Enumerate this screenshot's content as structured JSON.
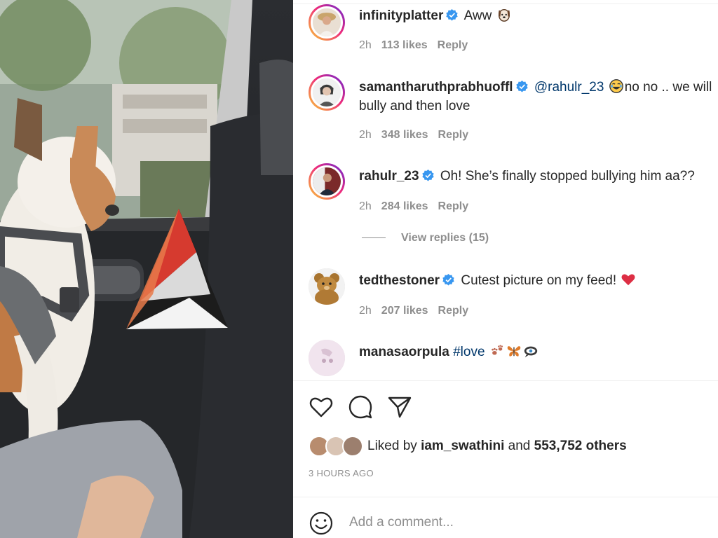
{
  "comments": [
    {
      "username": "infinityplatter",
      "verified": true,
      "text": "Aww",
      "emoji": "dog-face",
      "time": "2h",
      "likes": "113 likes",
      "reply": "Reply"
    },
    {
      "username": "samantharuthprabhuoffl",
      "verified": true,
      "mention": "@rahulr_23",
      "emoji": "laughing-face",
      "text_line1": "no no .. we will",
      "text_line2": "bully and then love",
      "time": "2h",
      "likes": "348 likes",
      "reply": "Reply"
    },
    {
      "username": "rahulr_23",
      "verified": true,
      "text": "Oh! She’s finally stopped bullying him aa??",
      "time": "2h",
      "likes": "284 likes",
      "reply": "Reply",
      "view_replies": "View replies (15)"
    },
    {
      "username": "tedthestoner",
      "verified": true,
      "text": "Cutest picture on my feed!",
      "emoji": "red-heart",
      "time": "2h",
      "likes": "207 likes",
      "reply": "Reply"
    },
    {
      "username": "manasaorpula",
      "verified": false,
      "hashtag": "#love",
      "emojis": [
        "paw-prints",
        "butterfly",
        "eye-in-speech-bubble"
      ]
    }
  ],
  "actions": {
    "like_icon": "heart-outline-icon",
    "comment_icon": "comment-bubble-icon",
    "share_icon": "paper-plane-icon"
  },
  "liked_by": {
    "prefix": "Liked by",
    "user": "iam_swathini",
    "conjunction": "and",
    "count": "553,752 others"
  },
  "timestamp": "3 HOURS AGO",
  "add_comment": {
    "placeholder": "Add a comment..."
  },
  "colors": {
    "verified_badge": "#3897f0",
    "muted_text": "#8e8e8e",
    "mention": "#00376b",
    "story_ring_start": "#f9ce34",
    "story_ring_end": "#6228d7"
  }
}
